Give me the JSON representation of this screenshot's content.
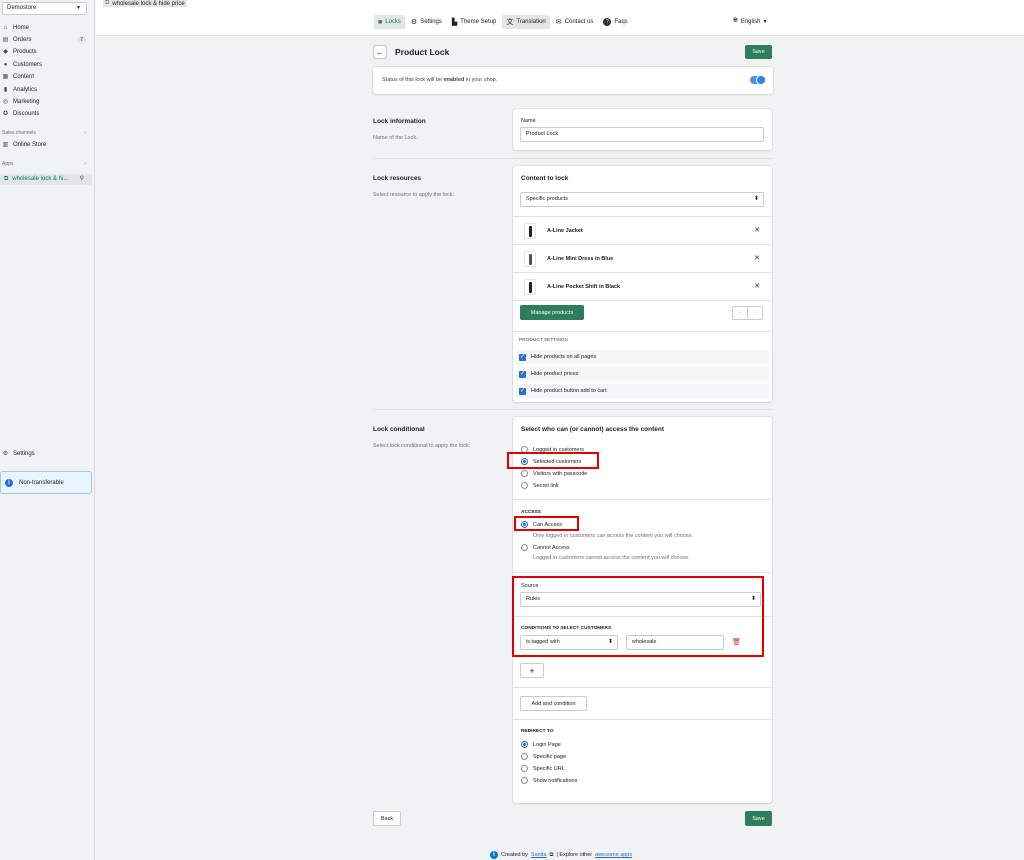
{
  "sidebar": {
    "store": "Demostore",
    "nav": [
      {
        "label": "Home",
        "icon": "home-icon",
        "glyph": "⌂"
      },
      {
        "label": "Orders",
        "icon": "orders-icon",
        "glyph": "▤",
        "badge": "7"
      },
      {
        "label": "Products",
        "icon": "tag-icon",
        "glyph": "◆"
      },
      {
        "label": "Customers",
        "icon": "person-icon",
        "glyph": "●"
      },
      {
        "label": "Content",
        "icon": "content-icon",
        "glyph": "▦"
      },
      {
        "label": "Analytics",
        "icon": "analytics-icon",
        "glyph": "▮"
      },
      {
        "label": "Marketing",
        "icon": "marketing-icon",
        "glyph": "◎"
      },
      {
        "label": "Discounts",
        "icon": "discount-icon",
        "glyph": "✪"
      }
    ],
    "sales_channels_label": "Sales channels",
    "online_store": "Online Store",
    "apps_label": "Apps",
    "app_item": "wholesale lock & hi...",
    "settings": "Settings",
    "non_transferable": "Non-transferable"
  },
  "topbar": {
    "app_title": "wholesale lock & hide price",
    "tabs": [
      {
        "label": "Locks",
        "icon": "lock-icon",
        "glyph": "🔒"
      },
      {
        "label": "Settings",
        "icon": "gear-icon",
        "glyph": "⚙"
      },
      {
        "label": "Theme Setup",
        "icon": "theme-icon",
        "glyph": "▙"
      },
      {
        "label": "Translation",
        "icon": "translate-icon",
        "glyph": "文"
      },
      {
        "label": "Contact us",
        "icon": "mail-icon",
        "glyph": "✉"
      },
      {
        "label": "Faqs",
        "icon": "help-icon",
        "glyph": "?"
      }
    ],
    "language": "English"
  },
  "page": {
    "title": "Product Lock",
    "save": "Save",
    "status_prefix": "Status of this lock will be ",
    "status_bold": "enabled",
    "status_suffix": " in your shop.",
    "lock_info": {
      "title": "Lock information",
      "desc": "Name of the Lock.",
      "name_label": "Name",
      "name_value": "Product Lock"
    },
    "lock_resources": {
      "title": "Lock resources",
      "desc": "Select resource to apply the lock.",
      "content_label": "Content to lock",
      "content_value": "Specific products",
      "products": [
        "A-Line Jacket",
        "A-Line Mini Dress in Blue",
        "A-Line Pocket Shift in Black"
      ],
      "manage_button": "Manage products",
      "settings_caption": "PRODUCT SETTINGS",
      "settings": [
        "Hide products on all pages",
        "Hide product prices",
        "Hide product button add to cart"
      ]
    },
    "lock_conditional": {
      "title": "Lock conditional",
      "desc": "Select lock conditional to apply the lock.",
      "who_title": "Select who can (or cannot) access the content",
      "who_options": [
        "Logged in customers",
        "Selected customers",
        "Visitors with passcode",
        "Secret link"
      ],
      "access_caption": "ACCESS",
      "can_access": "Can Access",
      "can_access_hint": "Only logged in customers can access the content you will choose.",
      "cannot_access": "Cannot Access",
      "cannot_access_hint": "Logged in customers cannot access the content you will choose.",
      "source_label": "Source",
      "source_value": "Rules",
      "conditions_caption": "CONDITIONS TO SELECT CUSTOMERS",
      "condition_op": "is tagged with",
      "condition_value": "wholesale",
      "add_plus": "+",
      "add_condition": "Add and condition",
      "redirect_caption": "REDIRECT TO",
      "redirect_options": [
        "Login Page",
        "Specific page",
        "Specific URL",
        "Show notifications"
      ]
    },
    "back": "Back"
  },
  "footer": {
    "created_by": "Created by",
    "author": "Sanita",
    "explore": "| Explore other",
    "link": "awesome apps"
  },
  "colors": {
    "primary": "#2e7d5b",
    "accent": "#2c6ecb",
    "highlight": "#e00000"
  }
}
